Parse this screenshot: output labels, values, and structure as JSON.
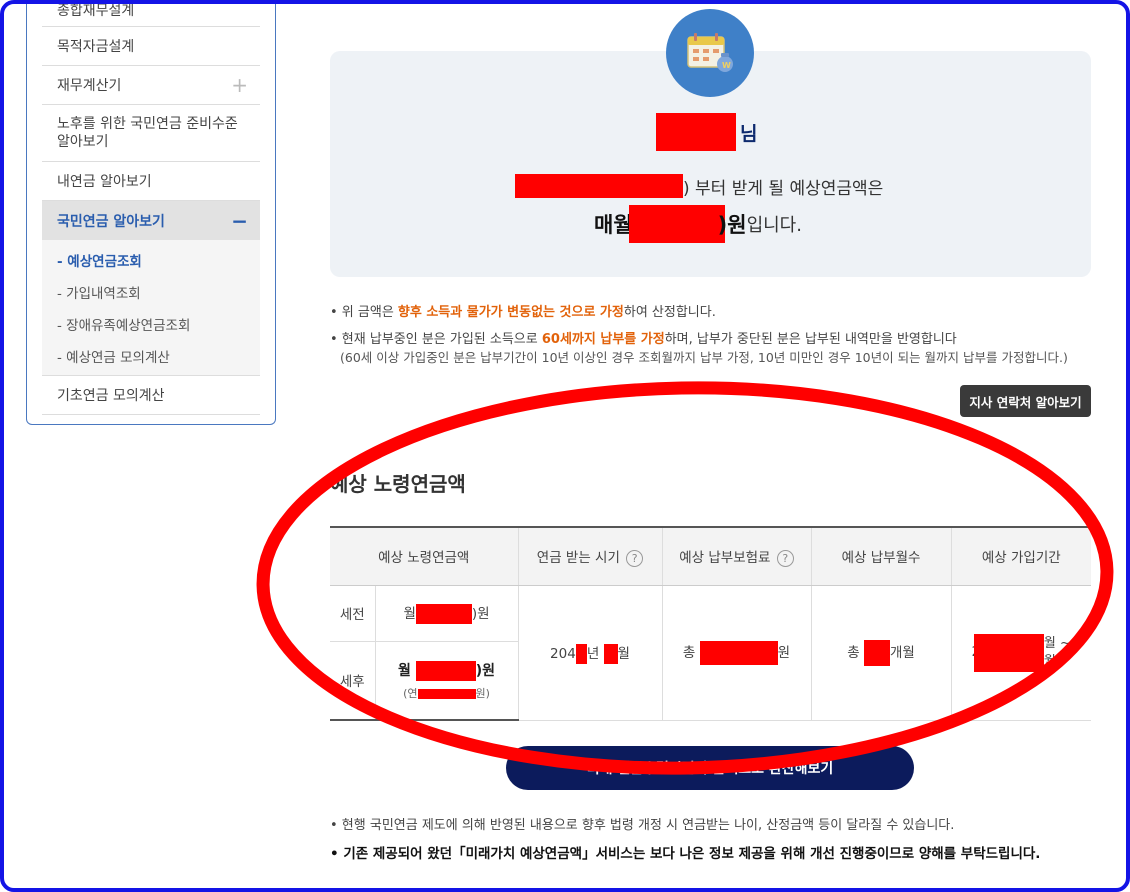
{
  "sidebar": {
    "items": [
      {
        "label": "종합재무설계"
      },
      {
        "label": "목적자금설계"
      },
      {
        "label": "재무계산기",
        "expand": "+"
      },
      {
        "label": "노후를 위한 국민연금 준비수준 알아보기"
      },
      {
        "label": "내연금 알아보기"
      },
      {
        "label": "국민연금 알아보기",
        "expand": "−"
      }
    ],
    "sub_items": [
      {
        "label": "- 예상연금조회"
      },
      {
        "label": "- 가입내역조회"
      },
      {
        "label": "- 장애유족예상연금조회"
      },
      {
        "label": "- 예상연금 모의계산"
      }
    ],
    "last_item": {
      "label": "기초연금 모의계산"
    }
  },
  "summary": {
    "name_suffix": "님",
    "line2_text": ") 부터 받게 될 예상연금액은",
    "line3_prefix": "매월",
    "line3_amount_suffix": ")원",
    "line3_suffix": "입니다."
  },
  "notes": {
    "n1_pre": "• 위 금액은 ",
    "n1_em": "향후 소득과 물가가 변동없는 것으로 가정",
    "n1_post": "하여 산정합니다.",
    "n2_pre": "• 현재 납부중인 분은 가입된 소득으로 ",
    "n2_em": "60세까지 납부를 가정",
    "n2_post": "하며, 납부가 중단된 분은 납부된 내역만을 반영합니다",
    "n2_small": "(60세 이상 가입중인 분은 납부기간이 10년 이상인 경우 조회월까지 납부 가정, 10년 미만인 경우 10년이 되는 월까지 납부를 가정합니다.)"
  },
  "branch_button": "지사 연락처 알아보기",
  "section_title": "예상 노령연금액",
  "table": {
    "headers": [
      "예상 노령연금액",
      "연금 받는 시기",
      "예상 납부보험료",
      "예상 납부월수",
      "예상 가입기간"
    ],
    "row_before_tax_label": "세전",
    "row_after_tax_label": "세후",
    "before_tax_prefix": "월",
    "before_tax_suffix": ")원",
    "after_tax_prefix": "월",
    "after_tax_suffix": ")원",
    "after_tax_year_prefix": "(연",
    "after_tax_year_suffix": "원)",
    "receive_prefix": "204",
    "receive_year": "년",
    "receive_month": "월",
    "premium_prefix": "총",
    "premium_suffix": "원",
    "months_prefix": "총",
    "months_suffix": "개월",
    "period_a": "2",
    "period_b": "월 ~",
    "period_c": "월"
  },
  "future_button": "미래 연금수령시점의 금액으로 환산해보기",
  "bottom_notes": {
    "b1": "• 현행 국민연금 제도에 의해 반영된 내용으로 향후 법령 개정 시 연금받는 나이, 산정금액 등이 달라질 수 있습니다.",
    "b2": "• 기존 제공되어 왔던「미래가치 예상연금액」서비스는 보다 나은 정보 제공을 위해 개선 진행중이므로 양해를 부탁드립니다."
  }
}
